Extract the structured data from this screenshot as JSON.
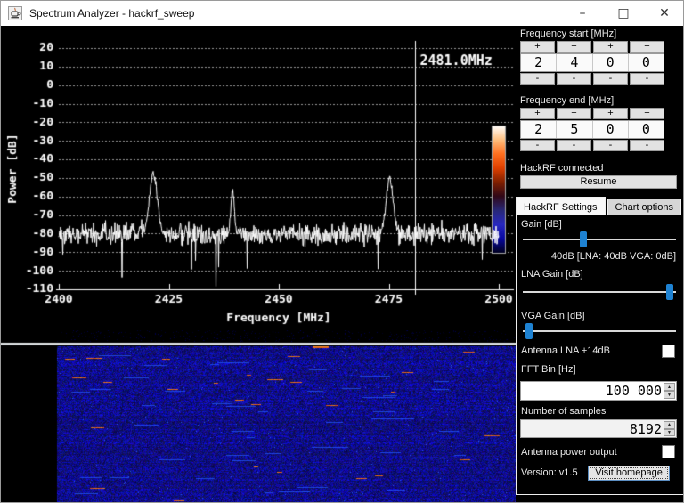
{
  "window": {
    "title": "Spectrum Analyzer - hackrf_sweep",
    "minimize": "–",
    "maximize": "□",
    "close": "✕"
  },
  "spin_labels": {
    "plus": "+",
    "minus": "-"
  },
  "frequency_start": {
    "label": "Frequency start [MHz]",
    "digits": [
      "2",
      "4",
      "0",
      "0"
    ]
  },
  "frequency_end": {
    "label": "Frequency end [MHz]",
    "digits": [
      "2",
      "5",
      "0",
      "0"
    ]
  },
  "status": {
    "text": "HackRF connected",
    "resume_label": "Resume"
  },
  "tabs": [
    {
      "label": "HackRF Settings",
      "active": true
    },
    {
      "label": "Chart options",
      "active": false
    }
  ],
  "settings": {
    "gain": {
      "label": "Gain [dB]",
      "value_text": "40dB [LNA: 40dB  VGA: 0dB]",
      "fraction": 0.39
    },
    "lna": {
      "label": "LNA Gain [dB]",
      "fraction": 0.98
    },
    "vga": {
      "label": "VGA Gain [dB]",
      "fraction": 0.02
    },
    "antenna_lna": {
      "label": "Antenna LNA +14dB",
      "checked": false
    },
    "fft_bin": {
      "label": "FFT Bin [Hz]",
      "value": "100 000"
    },
    "samples": {
      "label": "Number of samples",
      "value": "8192"
    },
    "antenna_power": {
      "label": "Antenna power output",
      "checked": false
    },
    "version_label": "Version: v1.5",
    "homepage_label": "Visit homepage"
  },
  "colors": {
    "accent_blue": "#1e82d2",
    "trace": "#ffffff",
    "grid": "#999999",
    "panel_text": "#e8e8e8"
  },
  "chart_data": [
    {
      "type": "line",
      "title": "",
      "xlabel": "Frequency [MHz]",
      "ylabel": "Power [dB]",
      "xlim": [
        2400,
        2500
      ],
      "ylim": [
        -110,
        20
      ],
      "xticks": [
        2400,
        2425,
        2450,
        2475,
        2500
      ],
      "yticks": [
        20,
        10,
        0,
        -10,
        -20,
        -30,
        -40,
        -50,
        -60,
        -70,
        -80,
        -90,
        -100,
        -110
      ],
      "grid": true,
      "legend": "none",
      "line_color": "#ffffff",
      "marker": {
        "freq_mhz": 2481.0,
        "label": "2481.0MHz"
      },
      "noise_floor_db": -80,
      "noise_spread_db": 6,
      "peaks": [
        {
          "freq_mhz": 2421.5,
          "power_db": -48,
          "width_mhz": 0.9
        },
        {
          "freq_mhz": 2439.5,
          "power_db": -57,
          "width_mhz": 0.4
        },
        {
          "freq_mhz": 2475.2,
          "power_db": -50,
          "width_mhz": 0.8
        }
      ],
      "colorbar_stops": [
        "#ffffff",
        "#ffc080",
        "#ff7020",
        "#e04000",
        "#802000",
        "#300818",
        "#282878",
        "#2828c0",
        "#0808a0",
        "#000020"
      ]
    },
    {
      "type": "heatmap",
      "title": "waterfall (power over time)",
      "x_range_mhz": [
        2400,
        2500
      ],
      "palette": {
        "background": "#000000",
        "noise_base": "#0000a0",
        "noise_bright": "#2040ff",
        "artifact": "#ff7a1a",
        "separator": "#e0e0e0"
      }
    }
  ]
}
